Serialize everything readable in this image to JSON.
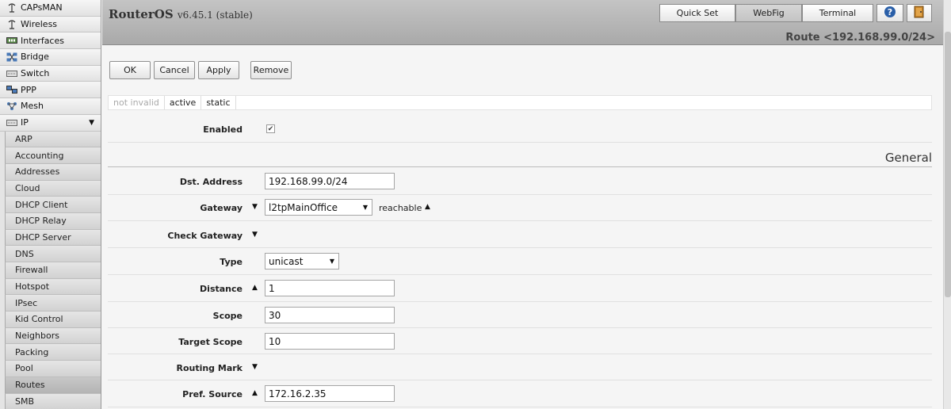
{
  "sidebar": {
    "top_items": [
      {
        "label": "CAPsMAN",
        "icon": "antenna-icon"
      },
      {
        "label": "Wireless",
        "icon": "antenna-icon"
      },
      {
        "label": "Interfaces",
        "icon": "interfaces-icon"
      },
      {
        "label": "Bridge",
        "icon": "bridge-icon"
      },
      {
        "label": "Switch",
        "icon": "switch-icon"
      },
      {
        "label": "PPP",
        "icon": "ppp-icon"
      },
      {
        "label": "Mesh",
        "icon": "mesh-icon"
      },
      {
        "label": "IP",
        "icon": "ip-icon"
      }
    ],
    "ip_caret": "▼",
    "sub_items": [
      "ARP",
      "Accounting",
      "Addresses",
      "Cloud",
      "DHCP Client",
      "DHCP Relay",
      "DHCP Server",
      "DNS",
      "Firewall",
      "Hotspot",
      "IPsec",
      "Kid Control",
      "Neighbors",
      "Packing",
      "Pool",
      "Routes",
      "SMB"
    ],
    "active_sub": "Routes"
  },
  "header": {
    "product": "RouterOS",
    "version": "v6.45.1 (stable)",
    "quick_set": "Quick Set",
    "webfig": "WebFig",
    "terminal": "Terminal",
    "help_icon": "help-icon",
    "logout_icon": "logout-icon",
    "route_title": "Route <192.168.99.0/24>"
  },
  "toolbar": {
    "ok": "OK",
    "cancel": "Cancel",
    "apply": "Apply",
    "remove": "Remove"
  },
  "flags": {
    "not_invalid": "not invalid",
    "active": "active",
    "static": "static"
  },
  "form": {
    "enabled_label": "Enabled",
    "enabled_checked": true,
    "enabled_mark": "✔",
    "section_general": "General",
    "dst_address_label": "Dst. Address",
    "dst_address": "192.168.99.0/24",
    "gateway_label": "Gateway",
    "gateway_value": "l2tpMainOffice",
    "gateway_status": "reachable",
    "check_gateway_label": "Check Gateway",
    "type_label": "Type",
    "type_value": "unicast",
    "distance_label": "Distance",
    "distance": "1",
    "scope_label": "Scope",
    "scope": "30",
    "target_scope_label": "Target Scope",
    "target_scope": "10",
    "routing_mark_label": "Routing Mark",
    "pref_source_label": "Pref. Source",
    "pref_source": "172.16.2.35"
  }
}
